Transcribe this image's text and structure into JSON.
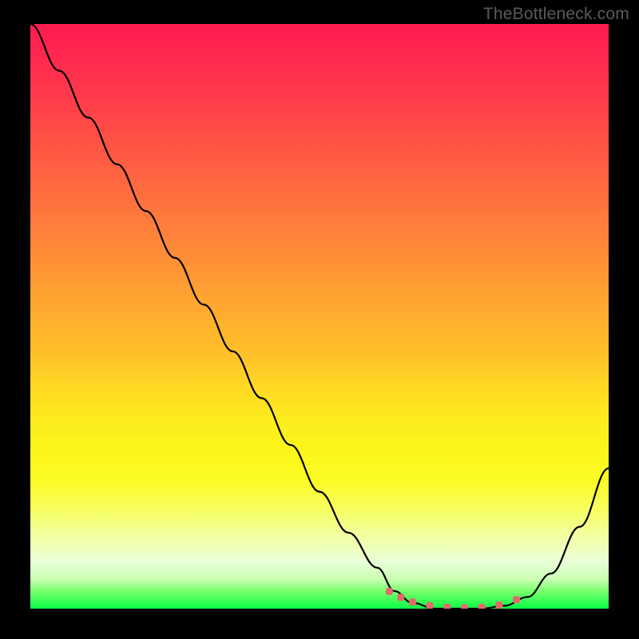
{
  "watermark": "TheBottleneck.com",
  "chart_data": {
    "type": "line",
    "title": "",
    "xlabel": "",
    "ylabel": "",
    "xlim": [
      0,
      100
    ],
    "ylim": [
      0,
      100
    ],
    "x": [
      0,
      5,
      10,
      15,
      20,
      25,
      30,
      35,
      40,
      45,
      50,
      55,
      60,
      63,
      66,
      70,
      74,
      78,
      82,
      86,
      90,
      95,
      100
    ],
    "values": [
      100,
      92,
      84,
      76,
      68,
      60,
      52,
      44,
      36,
      28,
      20,
      13,
      7,
      3,
      1,
      0,
      0,
      0,
      0.5,
      2,
      6,
      14,
      24
    ],
    "markers_x": [
      62,
      64,
      66,
      69,
      72,
      75,
      78,
      81,
      84
    ],
    "markers_y": [
      3.0,
      2.0,
      1.2,
      0.6,
      0.3,
      0.2,
      0.3,
      0.7,
      1.6
    ],
    "gradient_stops": [
      {
        "pos": 0,
        "color": "#ff1a50"
      },
      {
        "pos": 50,
        "color": "#ffb028"
      },
      {
        "pos": 75,
        "color": "#fdfd20"
      },
      {
        "pos": 100,
        "color": "#0dff45"
      }
    ]
  }
}
